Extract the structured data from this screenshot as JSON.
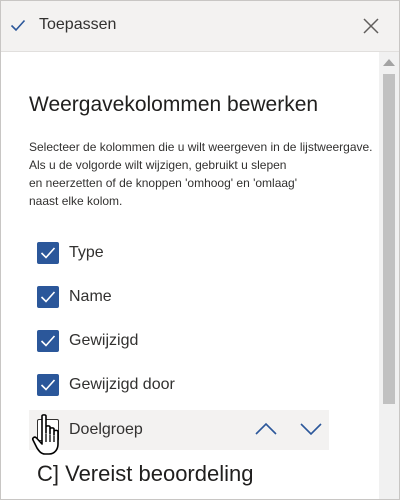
{
  "command_bar": {
    "apply_label": "Toepassen",
    "close_icon": "close-icon",
    "check_icon": "check-icon"
  },
  "panel": {
    "title": "Weergavekolommen bewerken",
    "description_lines": [
      "Selecteer de kolommen die u wilt weergeven in de lijstweergave.",
      "Als u de volgorde wilt wijzigen, gebruikt u slepen",
      "en neerzetten of de knoppen 'omhoog' en 'omlaag'",
      "naast elke kolom."
    ]
  },
  "columns": [
    {
      "label": "Type",
      "checked": true
    },
    {
      "label": "Name",
      "checked": true
    },
    {
      "label": "Gewijzigd",
      "checked": true
    },
    {
      "label": "Gewijzigd door",
      "checked": true
    },
    {
      "label": "Doelgroep",
      "checked": false
    }
  ],
  "partial_item": "C] Vereist beoordeling",
  "colors": {
    "accent": "#2b579a",
    "command_bar_bg": "#f3f2f1",
    "highlight_row": "#f3f2f1"
  },
  "icons": {
    "move_up": "chevron-up-icon",
    "move_down": "chevron-down-icon",
    "cursor": "hand-pointer-icon"
  }
}
